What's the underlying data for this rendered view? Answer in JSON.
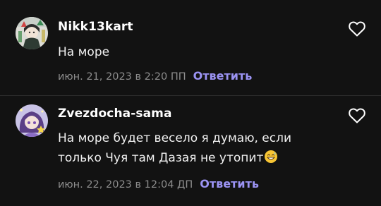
{
  "comments": [
    {
      "author": "Nikk13kart",
      "text_lines": [
        "На море"
      ],
      "date": "июн. 21, 2023 в 2:20 ПП",
      "reply_label": "Ответить",
      "like_icon": "heart-outline-icon"
    },
    {
      "author": "Zvezdocha-sama",
      "text_lines": [
        "На море будет весело я думаю, если",
        "только Чуя там Дазая не утопит"
      ],
      "emoji": "grinning-sweat-emoji",
      "date": "июн. 22, 2023 в 12:04 ДП",
      "reply_label": "Ответить",
      "like_icon": "heart-outline-icon"
    }
  ],
  "colors": {
    "background": "#121212",
    "reply_link": "#9b93f3",
    "meta_text": "#8d8d8d"
  }
}
